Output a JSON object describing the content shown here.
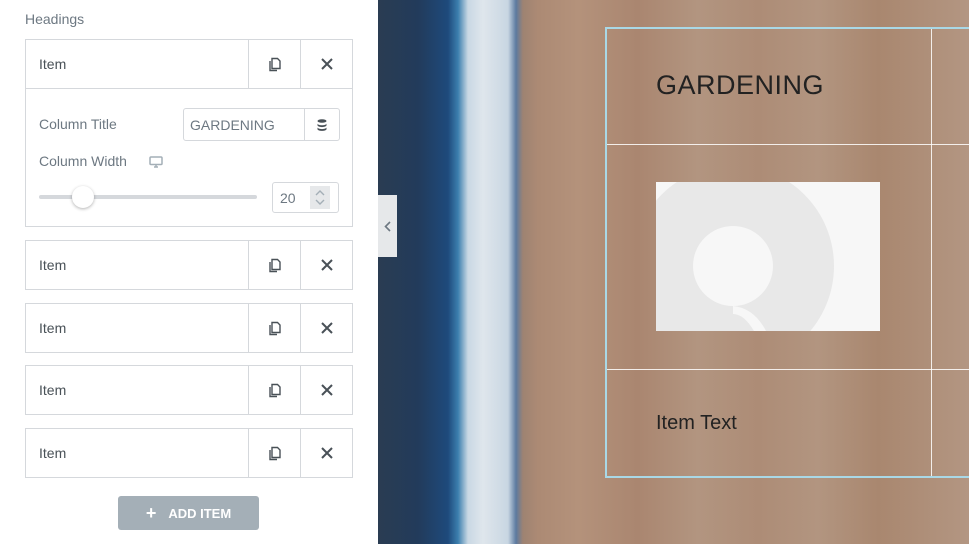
{
  "panel": {
    "section_label": "Headings",
    "items": [
      {
        "title": "Item",
        "expanded": true,
        "column_title_label": "Column Title",
        "column_title_value": "GARDENING",
        "column_width_label": "Column Width",
        "column_width_value": "20",
        "column_width_slider_percent": 20
      },
      {
        "title": "Item",
        "expanded": false
      },
      {
        "title": "Item",
        "expanded": false
      },
      {
        "title": "Item",
        "expanded": false
      },
      {
        "title": "Item",
        "expanded": false
      }
    ],
    "add_item_label": "ADD ITEM",
    "icons": {
      "duplicate": "duplicate-icon",
      "remove": "close-icon",
      "dynamic": "database-icon",
      "responsive": "desktop-icon",
      "add": "plus-icon",
      "collapse": "chevron-left-icon"
    }
  },
  "preview": {
    "column_heading": "GARDENING",
    "item_text": "Item Text",
    "accent_border": "#a9d8e6"
  }
}
